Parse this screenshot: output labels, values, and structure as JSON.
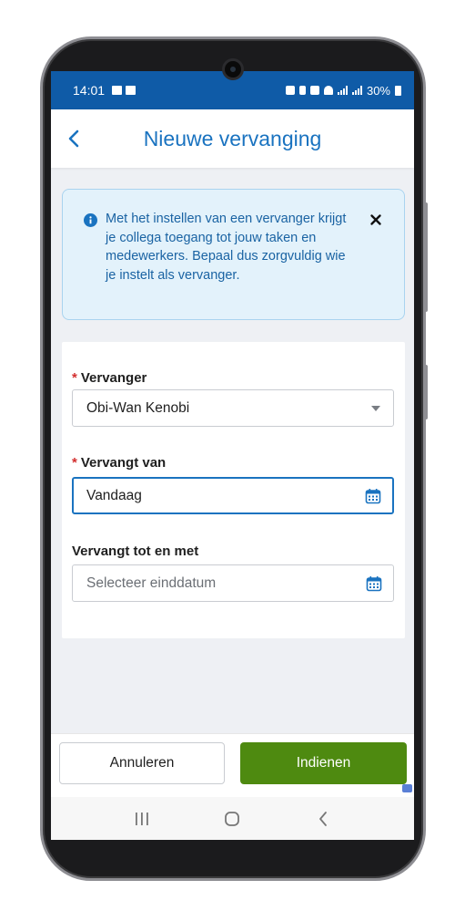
{
  "status_bar": {
    "time": "14:01",
    "battery": "30%"
  },
  "header": {
    "title": "Nieuwe vervanging",
    "back_icon": "chevron-left-icon"
  },
  "info_banner": {
    "text": "Met het instellen van een vervanger krijgt je collega toegang tot jouw taken en medewerkers. Bepaal dus zorgvuldig wie je instelt als vervanger.",
    "icon": "info-icon",
    "close_icon": "close-icon"
  },
  "form": {
    "required_mark": "*",
    "vervanger": {
      "label": "Vervanger",
      "value": "Obi-Wan Kenobi"
    },
    "van": {
      "label": "Vervangt van",
      "value": "Vandaag"
    },
    "tot": {
      "label": "Vervangt tot en met",
      "placeholder": "Selecteer einddatum"
    }
  },
  "footer": {
    "cancel_label": "Annuleren",
    "submit_label": "Indienen"
  },
  "colors": {
    "status_bar": "#0f5ba7",
    "accent": "#1a73c0",
    "info_bg": "#e3f2fb",
    "required": "#d32f2f",
    "submit": "#4e8a10"
  }
}
